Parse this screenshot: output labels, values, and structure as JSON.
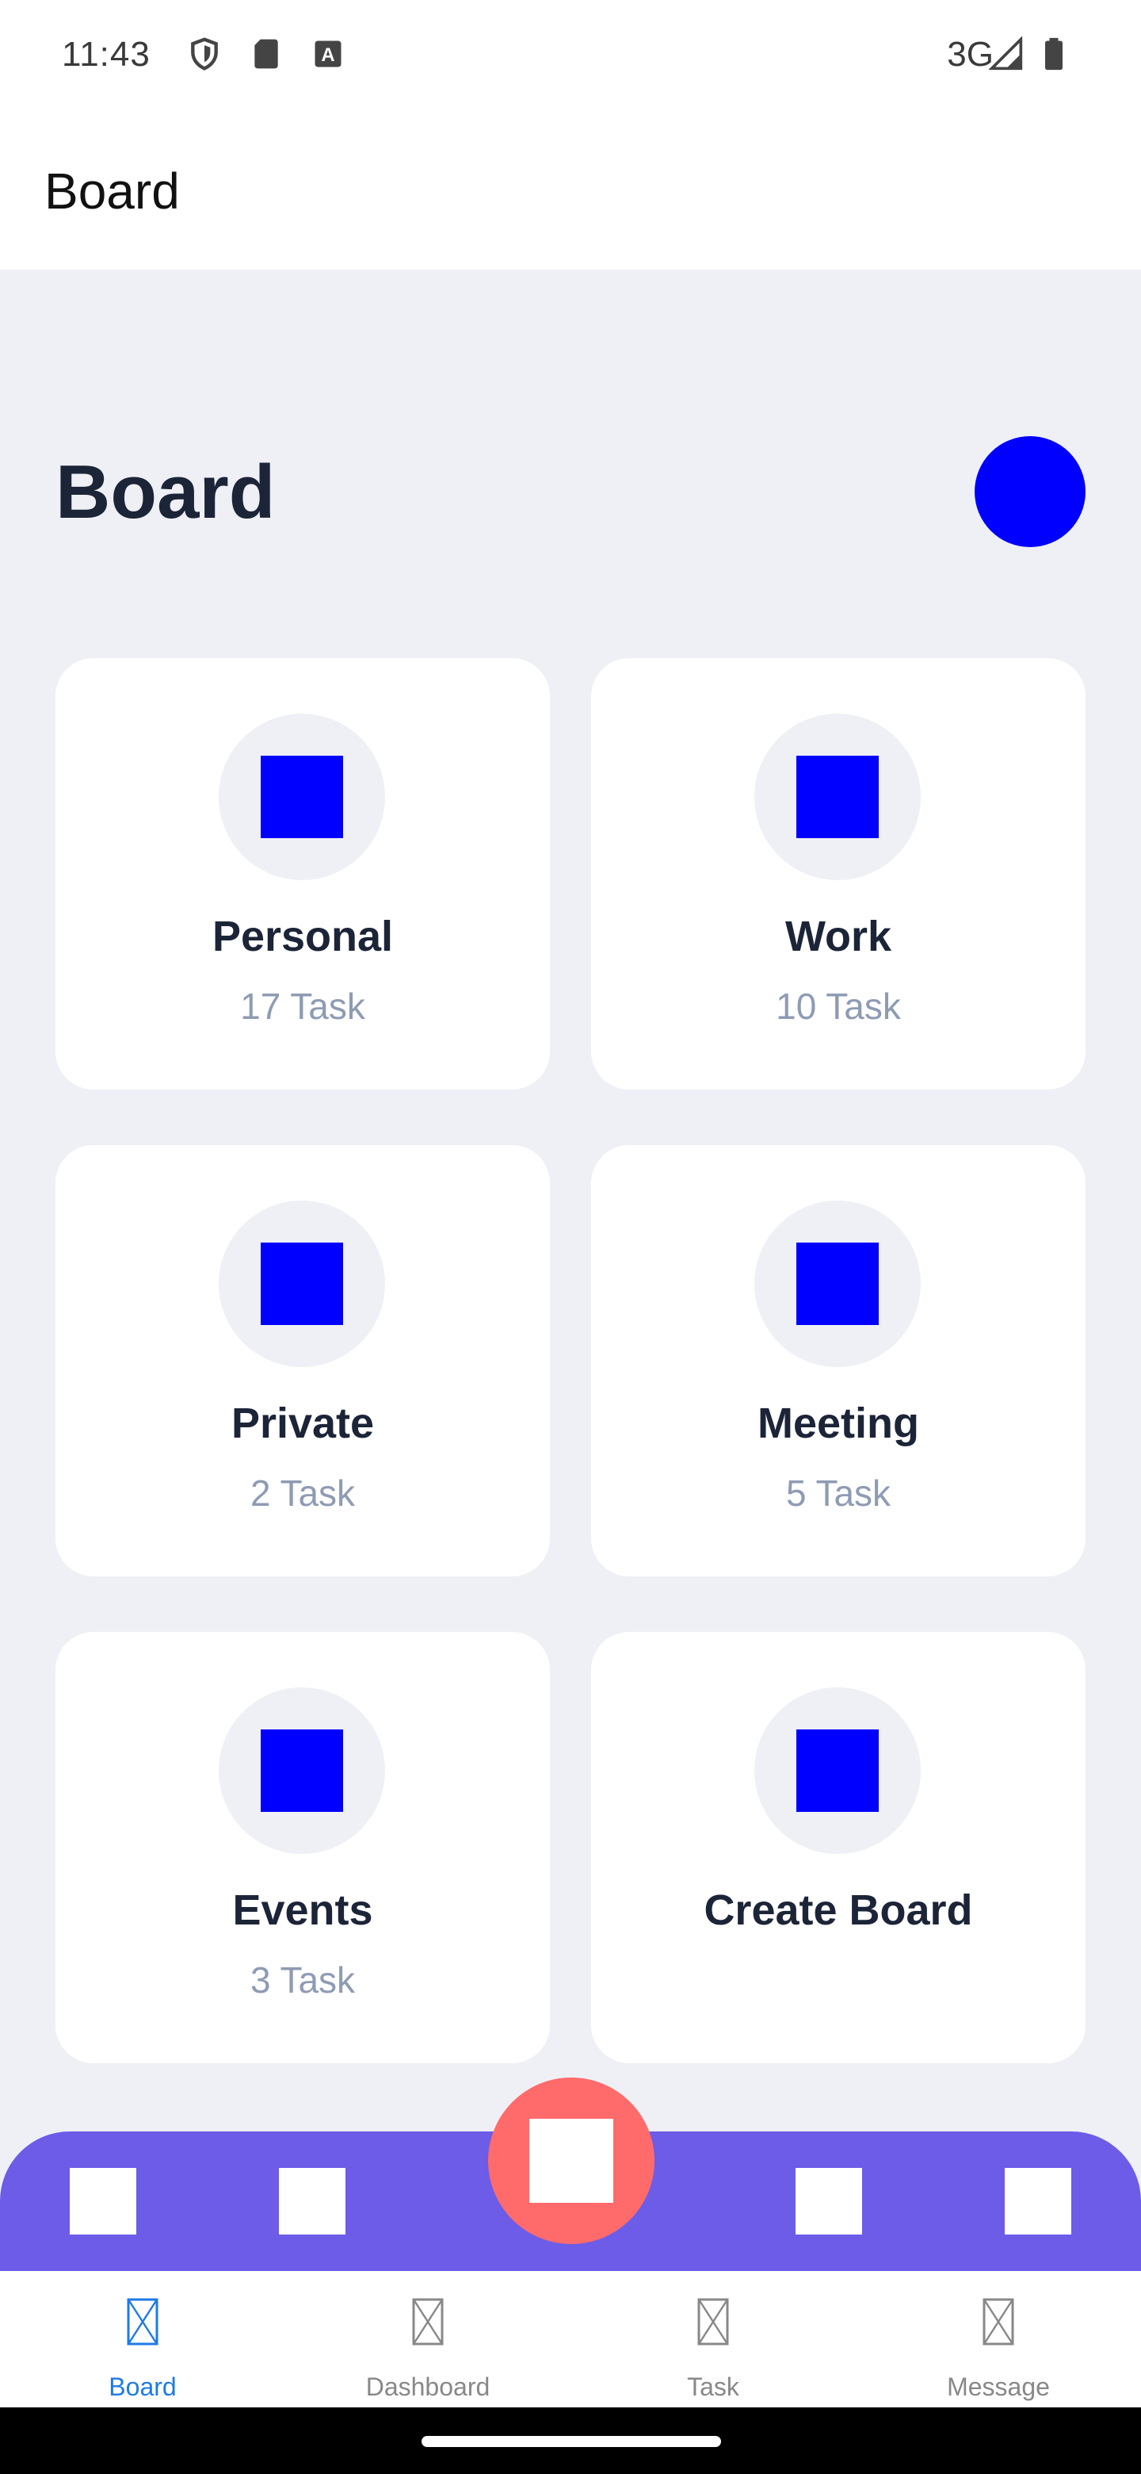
{
  "status_bar": {
    "time": "11:43",
    "network": "3G",
    "icons": [
      "shield-icon",
      "sd-card-icon",
      "keyboard-a-icon",
      "signal-icon",
      "battery-icon"
    ]
  },
  "app_bar": {
    "title": "Board"
  },
  "heading": "Board",
  "colors": {
    "background": "#eff0f5",
    "placeholder_blue": "#0000ff",
    "purple_bar": "#6c5ce7",
    "fab": "#ff6b6b",
    "nav_active": "#1e7be6",
    "subtitle": "#8e9bb3"
  },
  "boards": [
    {
      "title": "Personal",
      "count": "17 Task"
    },
    {
      "title": "Work",
      "count": "10 Task"
    },
    {
      "title": "Private",
      "count": "2 Task"
    },
    {
      "title": "Meeting",
      "count": "5 Task"
    },
    {
      "title": "Events",
      "count": "3 Task"
    },
    {
      "title": "Create Board",
      "count": ""
    }
  ],
  "bottom_nav": {
    "items": [
      {
        "label": "Board",
        "active": true
      },
      {
        "label": "Dashboard",
        "active": false
      },
      {
        "label": "Task",
        "active": false
      },
      {
        "label": "Message",
        "active": false
      }
    ]
  }
}
